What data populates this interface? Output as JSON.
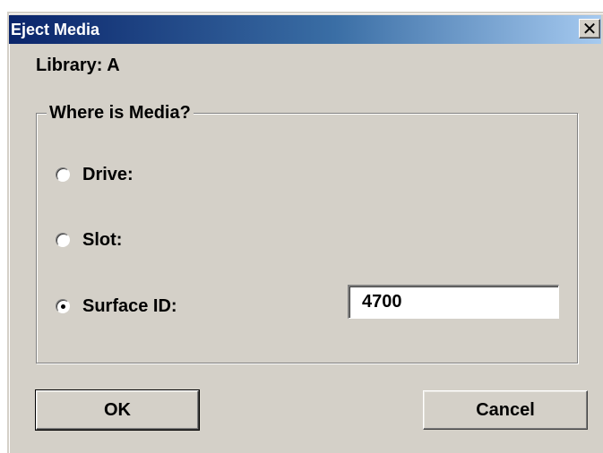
{
  "window": {
    "title": "Eject Media",
    "close_glyph": "✕"
  },
  "library": {
    "label": "Library: A"
  },
  "group": {
    "legend": "Where is Media?",
    "options": [
      {
        "label": "Drive:",
        "selected": false
      },
      {
        "label": "Slot:",
        "selected": false
      },
      {
        "label": "Surface ID:",
        "selected": true
      }
    ],
    "surface_id_value": "4700"
  },
  "buttons": {
    "ok_label": "OK",
    "cancel_label": "Cancel"
  },
  "colors": {
    "dialog_face": "#d4d0c8",
    "title_start": "#0a246a",
    "title_end": "#a6caf0"
  }
}
